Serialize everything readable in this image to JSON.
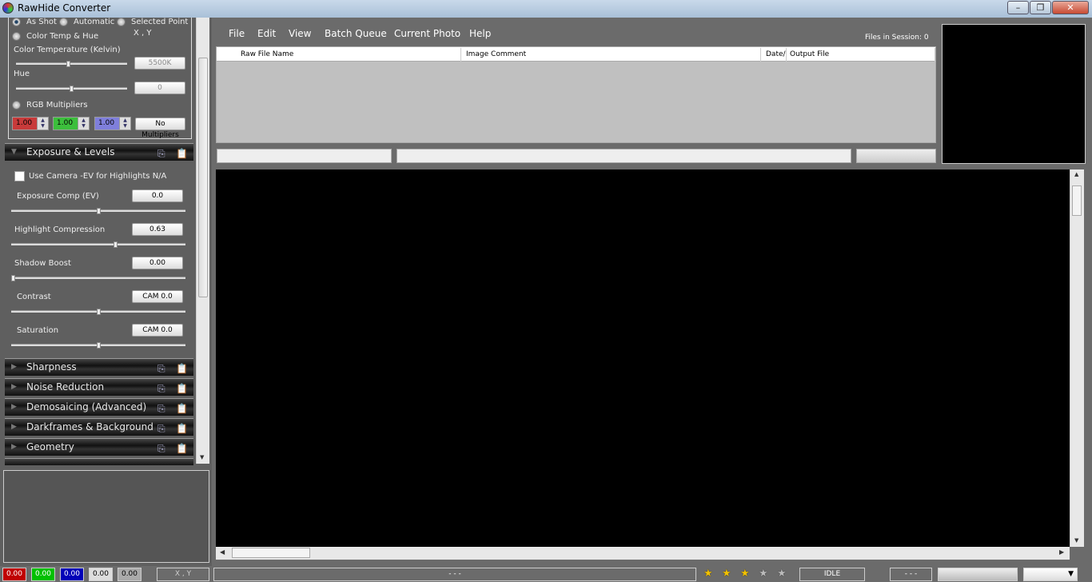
{
  "window": {
    "title": "RawHide Converter",
    "min": "–",
    "max": "❐",
    "close": "✕"
  },
  "white_balance": {
    "as_shot": "As Shot",
    "automatic": "Automatic",
    "selected_point": "Selected Point",
    "xy": "X , Y",
    "color_temp_hue": "Color Temp & Hue",
    "color_temperature_label": "Color Temperature (Kelvin)",
    "color_temperature_value": "5500K",
    "color_temperature_slider": 0.5,
    "hue_label": "Hue",
    "hue_value": "0",
    "hue_slider": 0.5,
    "rgb_multipliers": "RGB Multipliers",
    "red": "1.00",
    "green": "1.00",
    "blue": "1.00",
    "no_multipliers": "No Multipliers",
    "colors": {
      "red": "#c83a3a",
      "green": "#3cbf3c",
      "blue": "#7f7fdc"
    }
  },
  "exposure": {
    "title": "Exposure & Levels",
    "use_camera_ev": "Use Camera -EV for Highlights N/A",
    "controls": [
      {
        "label": "Exposure Comp (EV)",
        "value": "0.0",
        "slider": 0.5
      },
      {
        "label": "Highlight Compression",
        "value": "0.63",
        "slider": 0.6
      },
      {
        "label": "Shadow Boost",
        "value": "0.00",
        "slider": 0.0
      },
      {
        "label": "Contrast",
        "value": "CAM 0.0",
        "slider": 0.5
      },
      {
        "label": "Saturation",
        "value": "CAM 0.0",
        "slider": 0.5
      }
    ]
  },
  "sections": [
    "Sharpness",
    "Noise Reduction",
    "Demosaicing (Advanced)",
    "Darkframes & Background",
    "Geometry"
  ],
  "menu": [
    "File",
    "Edit",
    "View",
    "Batch Queue",
    "Current Photo",
    "Help"
  ],
  "files_in_session": "Files in Session: 0",
  "table": {
    "columns": [
      "Raw File Name",
      "Image Comment",
      "Date/",
      "Output File"
    ]
  },
  "statusbar": {
    "r": "0.00",
    "g": "0.00",
    "b": "0.00",
    "l1": "0.00",
    "l2": "0.00",
    "xy": "X , Y",
    "info": "- - -",
    "rating": 3,
    "rating_max": 5,
    "status": "IDLE",
    "extra": "- - -"
  }
}
